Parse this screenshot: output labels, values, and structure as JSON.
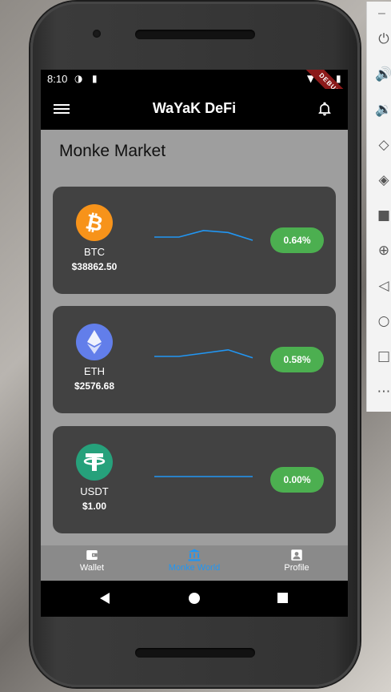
{
  "status_bar": {
    "time": "8:10",
    "debug_label": "DEBUG"
  },
  "app_bar": {
    "title": "WaYaK DeFi",
    "menu_icon": "menu-icon",
    "bell_icon": "bell-icon"
  },
  "page": {
    "title": "Monke Market"
  },
  "coins": [
    {
      "symbol": "BTC",
      "price": "$38862.50",
      "change": "0.64%",
      "logo_color": "#f7931a",
      "spark": [
        0.0,
        0.0,
        0.63,
        0.44,
        -0.31
      ]
    },
    {
      "symbol": "ETH",
      "price": "$2576.68",
      "change": "0.58%",
      "logo_color": "#627eea",
      "spark": [
        0.0,
        0.0,
        0.31,
        0.63,
        -0.13
      ]
    },
    {
      "symbol": "USDT",
      "price": "$1.00",
      "change": "0.00%",
      "logo_color": "#26a17b",
      "spark": [
        0.0,
        0.0,
        0.0,
        0.0,
        0.0
      ]
    }
  ],
  "colors": {
    "accent": "#2196f3",
    "positive": "#4caf50",
    "card": "#424242",
    "spark_line": "#2196f3"
  },
  "bottom_nav": [
    {
      "label": "Wallet",
      "icon": "wallet-icon",
      "active": false
    },
    {
      "label": "Monke World",
      "icon": "bank-icon",
      "active": true
    },
    {
      "label": "Profile",
      "icon": "profile-icon",
      "active": false
    }
  ]
}
